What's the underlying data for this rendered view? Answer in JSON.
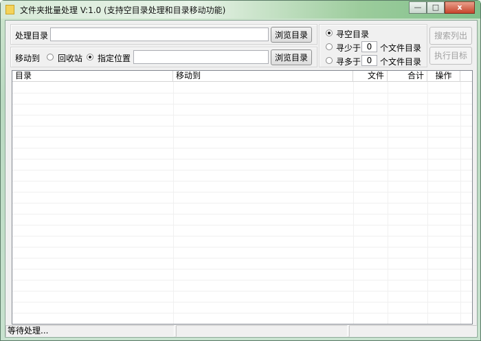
{
  "window": {
    "title": "文件夹批量处理 V:1.0 (支持空目录处理和目录移动功能)",
    "minimize": "—",
    "maximize": "□",
    "close": "x"
  },
  "process": {
    "label": "处理目录",
    "value": "",
    "browse": "浏览目录"
  },
  "move": {
    "label": "移动到",
    "recycle": "回收站",
    "specified": "指定位置",
    "value": "",
    "browse": "浏览目录",
    "selected": "specified"
  },
  "search": {
    "empty": "寻空目录",
    "less_prefix": "寻少于",
    "less_value": "0",
    "less_suffix": "个文件目录",
    "more_prefix": "寻多于",
    "more_value": "0",
    "more_suffix": "个文件目录",
    "selected": "empty"
  },
  "actions": {
    "search": "搜索列出",
    "execute": "执行目标"
  },
  "table": {
    "columns": [
      "目录",
      "移动到",
      "文件",
      "合计",
      "操作"
    ],
    "rows": []
  },
  "status": {
    "text": "等待处理...",
    "panel2": "",
    "panel3": ""
  }
}
